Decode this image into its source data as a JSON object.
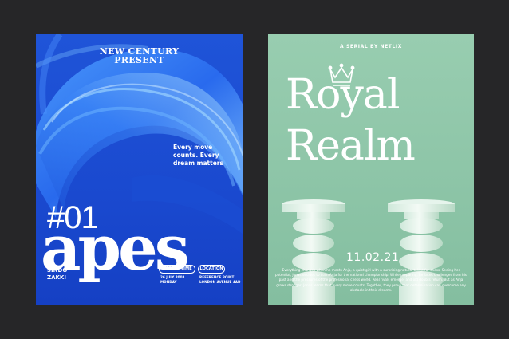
{
  "left_poster": {
    "header_line1": "NEW CENTURY",
    "header_line2": "PRESENT",
    "tagline": "Every move counts. Every dream matters",
    "issue": "#01",
    "title": "apes",
    "author_line1": "SINDO",
    "author_line2": "ZAKKI",
    "date_label": "DATE & TIME",
    "date_line1": "26 JULY 2003",
    "date_line2": "MONDAY",
    "location_label": "LOCATION",
    "location_line1": "REFERENCE POINT",
    "location_line2": "LONDON AVENUE 4AD"
  },
  "right_poster": {
    "serial": "A SERIAL BY NETLIX",
    "title_line1": "Royal",
    "title_line2": "Realm",
    "date": "11.02.21",
    "body": "Everything changes when he meets Anja, a quiet girl with a surprising natural talent for chess. Seeing her potential, Jonas decides to train Anja for the national championship. While preparing, he faces challenges from his past and the pressures of the professional chess world. Real rivals emerge, and old doubts return. But as Anja grows stronger, Jonas learns that every move counts. Together, they prove that determination can overcome any obstacle in their dreams."
  },
  "colors": {
    "background": "#262628",
    "left_poster_blue": "#1747d0",
    "right_poster_mint": "#8fc7a9",
    "text": "#ffffff"
  }
}
